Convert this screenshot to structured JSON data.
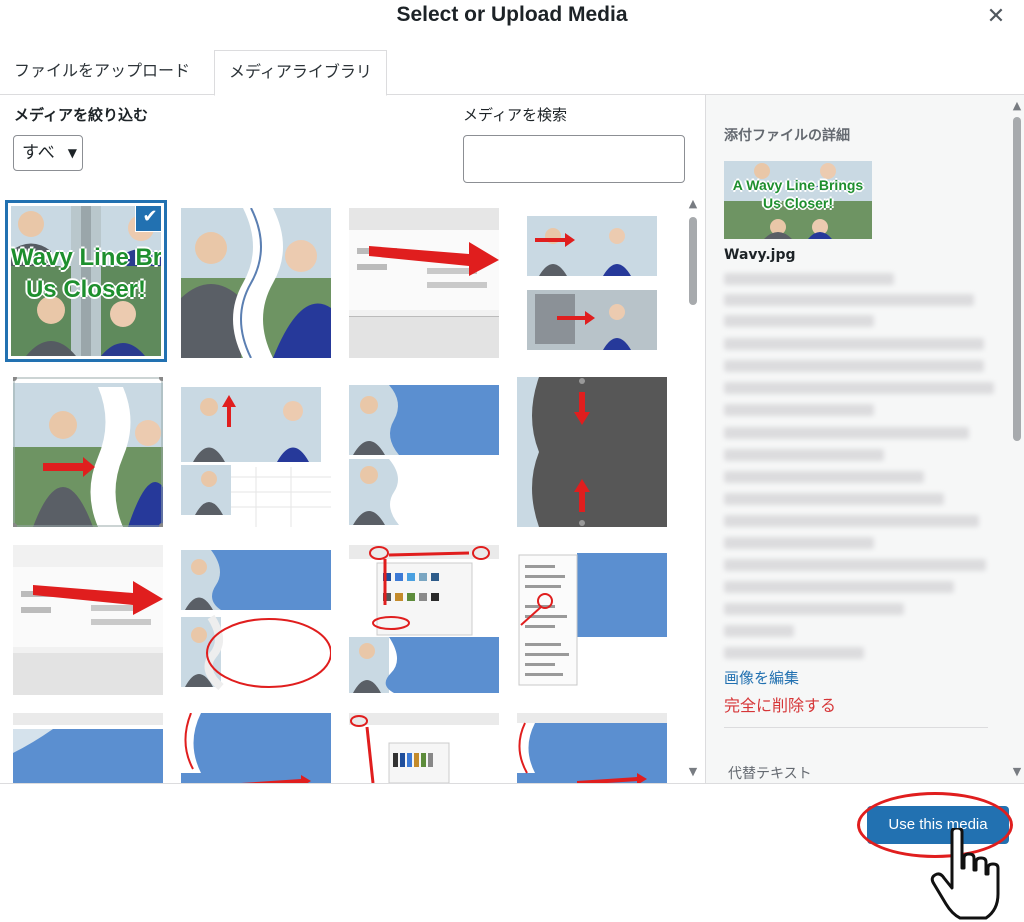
{
  "modal": {
    "title": "Select or Upload Media",
    "close_symbol": "✕"
  },
  "tabs": [
    {
      "label": "ファイルをアップロード",
      "active": false
    },
    {
      "label": "メディアライブラリ",
      "active": true
    }
  ],
  "filter": {
    "label": "メディアを絞り込む",
    "selected": "すべ"
  },
  "search": {
    "label": "メディアを検索",
    "value": ""
  },
  "grid": {
    "selected_index": 0,
    "selected_thumb_text_line1": "Wavy Line Bri",
    "selected_thumb_text_line2": "Us Closer!",
    "items": [
      {
        "kind": "title-photo"
      },
      {
        "kind": "couple-wave"
      },
      {
        "kind": "ribbon-arrow"
      },
      {
        "kind": "sheet-couple"
      },
      {
        "kind": "couple-select"
      },
      {
        "kind": "sheet-arrows"
      },
      {
        "kind": "blue-wave-stack"
      },
      {
        "kind": "dark-arrows"
      },
      {
        "kind": "ribbon-arrow"
      },
      {
        "kind": "blue-wave-oval"
      },
      {
        "kind": "color-picker"
      },
      {
        "kind": "context-menu"
      },
      {
        "kind": "blue-band"
      },
      {
        "kind": "blue-wave-left"
      },
      {
        "kind": "color-picker-small"
      },
      {
        "kind": "blue-wave-arrow"
      }
    ]
  },
  "sidebar": {
    "heading": "添付ファイルの詳細",
    "thumb_text_line1": "A Wavy Line Brings",
    "thumb_text_line2": "Us Closer!",
    "filename": "Wavy.jpg",
    "edit_link": "画像を編集",
    "delete_link": "完全に削除する",
    "alt_label": "代替テキスト"
  },
  "footer": {
    "primary_button": "Use this media"
  },
  "colors": {
    "accent": "#2271b1",
    "danger": "#d63638",
    "annotation_red": "#e01e1e",
    "wave_blue": "#5b8fd0"
  }
}
